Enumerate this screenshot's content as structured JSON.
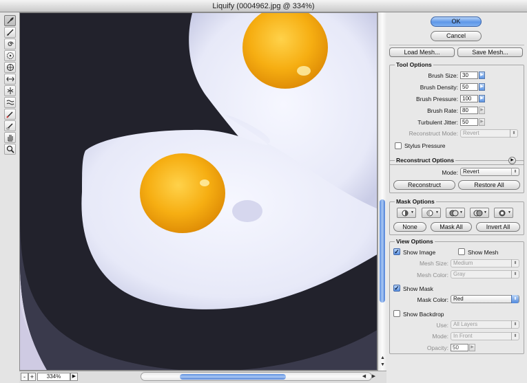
{
  "window": {
    "title": "Liquify (0004962.jpg @ 334%)"
  },
  "toolbar": {
    "tools": [
      {
        "name": "forward-warp-tool",
        "icon": "brush-icon",
        "active": true
      },
      {
        "name": "reconstruct-tool",
        "icon": "reconstruct-brush-icon"
      },
      {
        "name": "twirl-clockwise-tool",
        "icon": "twirl-icon"
      },
      {
        "name": "pucker-tool",
        "icon": "pucker-icon"
      },
      {
        "name": "bloat-tool",
        "icon": "bloat-icon"
      },
      {
        "name": "push-left-tool",
        "icon": "push-left-icon"
      },
      {
        "name": "mirror-tool",
        "icon": "mirror-icon"
      },
      {
        "name": "turbulence-tool",
        "icon": "turbulence-icon"
      },
      {
        "name": "freeze-mask-tool",
        "icon": "freeze-icon"
      },
      {
        "name": "thaw-mask-tool",
        "icon": "thaw-icon"
      },
      {
        "name": "hand-tool",
        "icon": "hand-icon"
      },
      {
        "name": "zoom-tool",
        "icon": "zoom-icon"
      }
    ]
  },
  "statusbar": {
    "zoom_minus": "-",
    "zoom_plus": "+",
    "zoom": "334%"
  },
  "actions": {
    "ok": "OK",
    "cancel": "Cancel",
    "load_mesh": "Load Mesh...",
    "save_mesh": "Save Mesh..."
  },
  "tool_options": {
    "title": "Tool Options",
    "brush_size_label": "Brush Size:",
    "brush_size": "30",
    "brush_density_label": "Brush Density:",
    "brush_density": "50",
    "brush_pressure_label": "Brush Pressure:",
    "brush_pressure": "100",
    "brush_rate_label": "Brush Rate:",
    "brush_rate": "80",
    "turbulent_jitter_label": "Turbulent Jitter:",
    "turbulent_jitter": "50",
    "reconstruct_mode_label": "Reconstruct Mode:",
    "reconstruct_mode": "Revert",
    "stylus_pressure": "Stylus Pressure"
  },
  "reconstruct_options": {
    "title": "Reconstruct Options",
    "mode_label": "Mode:",
    "mode": "Revert",
    "reconstruct": "Reconstruct",
    "restore_all": "Restore All"
  },
  "mask_options": {
    "title": "Mask Options",
    "none": "None",
    "mask_all": "Mask All",
    "invert_all": "Invert All"
  },
  "view_options": {
    "title": "View Options",
    "show_image": "Show Image",
    "show_image_checked": true,
    "show_mesh": "Show Mesh",
    "show_mesh_checked": false,
    "mesh_size_label": "Mesh Size:",
    "mesh_size": "Medium",
    "mesh_color_label": "Mesh Color:",
    "mesh_color": "Gray",
    "show_mask": "Show Mask",
    "show_mask_checked": true,
    "mask_color_label": "Mask Color:",
    "mask_color": "Red",
    "show_backdrop": "Show Backdrop",
    "show_backdrop_checked": false,
    "use_label": "Use:",
    "use": "All Layers",
    "mode_label": "Mode:",
    "mode": "In Front",
    "opacity_label": "Opacity:",
    "opacity": "50"
  },
  "colors": {
    "accent": "#5e97e8",
    "egg_yolk": "#f7b318",
    "egg_white": "#eef0fb",
    "pan": "#1f1f29"
  }
}
